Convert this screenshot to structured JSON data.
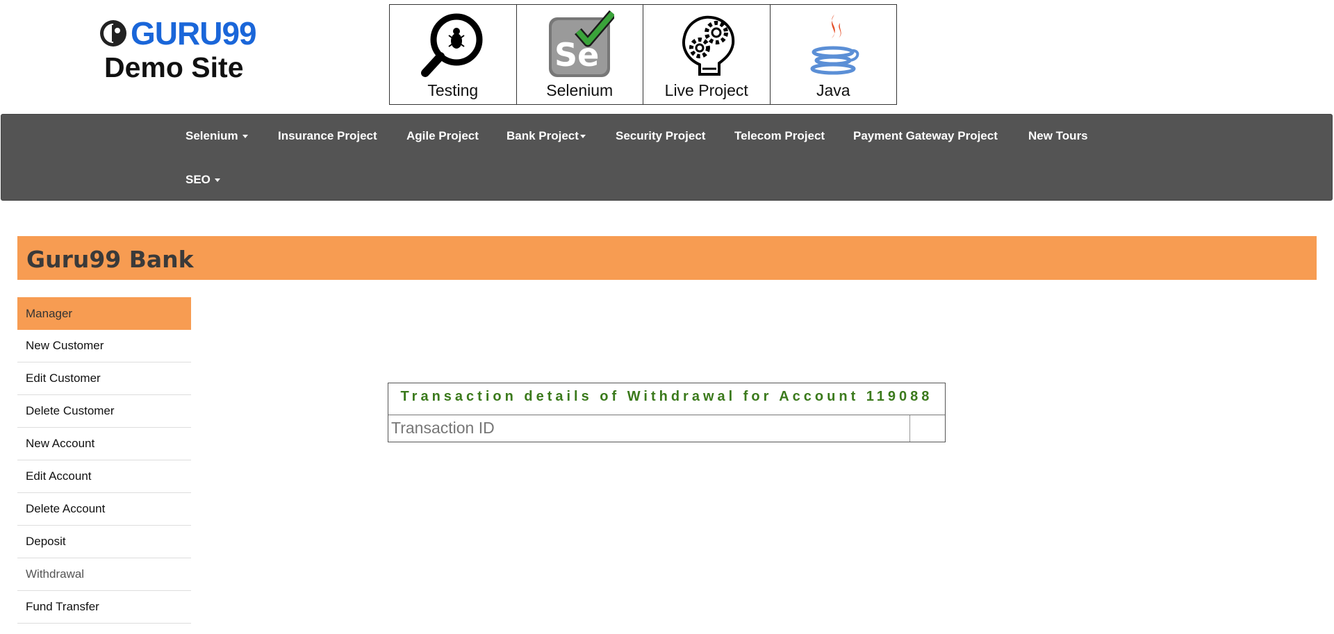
{
  "brand": {
    "logo_text": "GURU99",
    "subtitle": "Demo Site",
    "accent_color": "#1a66d9"
  },
  "tiles": [
    {
      "label": "Testing",
      "icon": "magnifier-bug-icon"
    },
    {
      "label": "Selenium",
      "icon": "selenium-check-icon"
    },
    {
      "label": "Live Project",
      "icon": "lightbulb-gears-icon"
    },
    {
      "label": "Java",
      "icon": "java-cup-icon"
    }
  ],
  "nav": {
    "items": [
      {
        "label": "Selenium",
        "dropdown": true
      },
      {
        "label": "Insurance Project"
      },
      {
        "label": "Agile Project"
      },
      {
        "label": "Bank Project",
        "dropdown": true
      },
      {
        "label": "Security Project"
      },
      {
        "label": "Telecom Project"
      },
      {
        "label": "Payment Gateway Project"
      },
      {
        "label": "New Tours"
      },
      {
        "label": "SEO",
        "dropdown": true
      }
    ],
    "background": "#545454"
  },
  "bank": {
    "title": "Guru99 Bank",
    "color": "#f79c52"
  },
  "sidebar": {
    "items": [
      {
        "label": "Manager"
      },
      {
        "label": "New Customer"
      },
      {
        "label": "Edit Customer"
      },
      {
        "label": "Delete Customer"
      },
      {
        "label": "New Account"
      },
      {
        "label": "Edit Account"
      },
      {
        "label": "Delete Account"
      },
      {
        "label": "Deposit"
      },
      {
        "label": "Withdrawal"
      },
      {
        "label": "Fund Transfer"
      }
    ]
  },
  "transaction": {
    "heading": "Transaction details of Withdrawal for Account 119088",
    "heading_color": "#3b7a1c",
    "rows": [
      {
        "label": "Transaction ID",
        "value": ""
      }
    ]
  }
}
